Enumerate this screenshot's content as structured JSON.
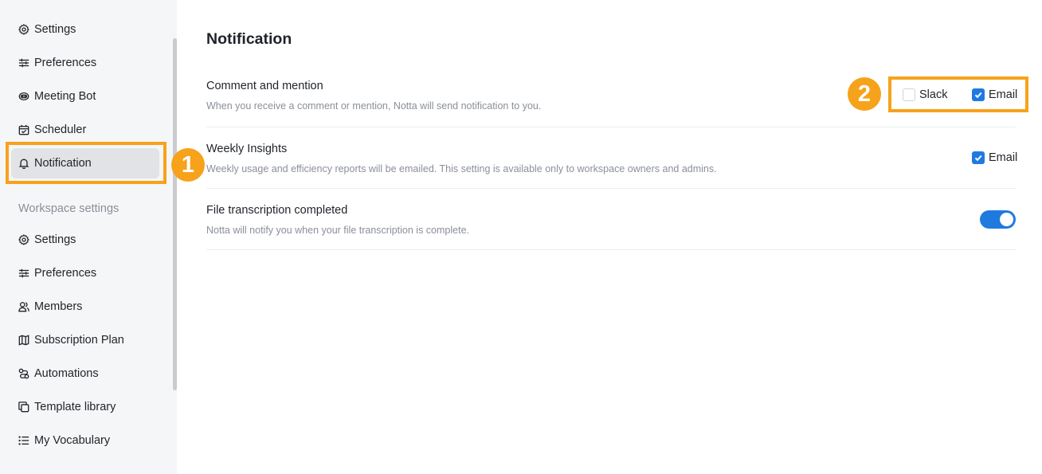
{
  "sidebar": {
    "personal_items": [
      {
        "label": "Settings",
        "icon": "gear-icon"
      },
      {
        "label": "Preferences",
        "icon": "sliders-icon"
      },
      {
        "label": "Meeting Bot",
        "icon": "bot-icon"
      },
      {
        "label": "Scheduler",
        "icon": "calendar-icon"
      },
      {
        "label": "Notification",
        "icon": "bell-icon",
        "active": true
      }
    ],
    "workspace_label": "Workspace settings",
    "workspace_items": [
      {
        "label": "Settings",
        "icon": "gear-icon"
      },
      {
        "label": "Preferences",
        "icon": "sliders-icon"
      },
      {
        "label": "Members",
        "icon": "members-icon"
      },
      {
        "label": "Subscription Plan",
        "icon": "map-icon"
      },
      {
        "label": "Automations",
        "icon": "automations-icon"
      },
      {
        "label": "Template library",
        "icon": "template-icon"
      },
      {
        "label": "My Vocabulary",
        "icon": "list-icon"
      }
    ]
  },
  "annotations": {
    "badge_1": "1",
    "badge_2": "2",
    "accent_color": "#f7a21b"
  },
  "main": {
    "title": "Notification",
    "rows": [
      {
        "title": "Comment and mention",
        "description": "When you receive a comment or mention, Notta will send notification to you.",
        "options": [
          {
            "label": "Slack",
            "checked": false
          },
          {
            "label": "Email",
            "checked": true
          }
        ]
      },
      {
        "title": "Weekly Insights",
        "description": "Weekly usage and efficiency reports will be emailed. This setting is available only to workspace owners and admins.",
        "options": [
          {
            "label": "Email",
            "checked": true
          }
        ]
      },
      {
        "title": "File transcription completed",
        "description": "Notta will notify you when your file transcription is complete.",
        "toggle_on": true
      }
    ]
  },
  "colors": {
    "primary_blue": "#1f7ae0",
    "sidebar_bg": "#f5f6f7",
    "active_item_bg": "#e1e3e6"
  }
}
